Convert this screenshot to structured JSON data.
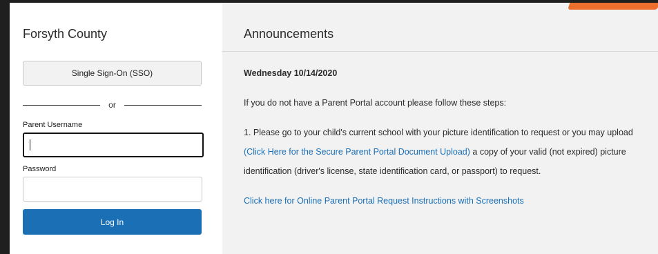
{
  "login": {
    "district": "Forsyth County",
    "sso_label": "Single Sign-On (SSO)",
    "divider_text": "or",
    "username_label": "Parent Username",
    "username_value": "",
    "password_label": "Password",
    "password_value": "",
    "login_button": "Log In"
  },
  "announcements": {
    "title": "Announcements",
    "date": "Wednesday 10/14/2020",
    "intro": "If you do not have a Parent Portal account please follow these steps:",
    "step1_pre": "1.  Please go to your child's current school with your picture identification to request or you may upload ",
    "step1_link": "(Click Here for the Secure Parent Portal Document Upload)",
    "step1_post": " a copy of your valid (not expired) picture identification (driver's license, state identification card, or passport) to request.",
    "instructions_link": "Click here for Online Parent Portal Request Instructions with Screenshots"
  },
  "colors": {
    "primary_button": "#1b6fb5",
    "accent_tab": "#ee6f2d",
    "panel_bg": "#f2f2f2"
  }
}
